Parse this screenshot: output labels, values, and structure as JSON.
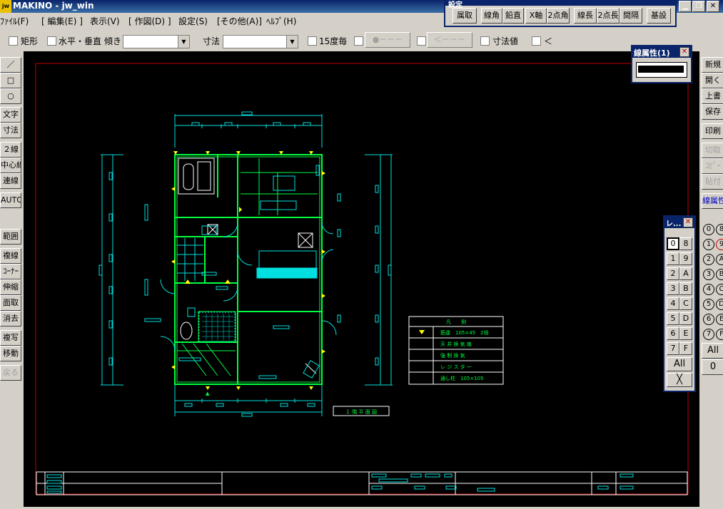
{
  "window": {
    "title": "MAKINO - jw_win",
    "icon": "jw"
  },
  "menu": [
    {
      "label": "ﾌｧｲﾙ(F)"
    },
    {
      "label": "[ 編集(E) ]"
    },
    {
      "label": "表示(V)"
    },
    {
      "label": "[ 作図(D) ]"
    },
    {
      "label": "設定(S)"
    },
    {
      "label": "[その他(A)]"
    },
    {
      "label": "ﾍﾙﾌﾟ(H)"
    }
  ],
  "settings_panel": {
    "title": "設定",
    "buttons": [
      "属取",
      "線角",
      "鉛直",
      "X軸",
      "2点角",
      "線長",
      "2点長",
      "間隔",
      "基設"
    ]
  },
  "toolbar": {
    "rect_label": "矩形",
    "hv_label": "水平・垂直",
    "slope_label": "傾き",
    "dim_label": "寸法",
    "deg15_label": "15度毎",
    "circle_btn": "●－－－",
    "arrow_btn": "＜－－－",
    "dimval_label": "寸法値",
    "lt_label": "＜"
  },
  "left_tools": [
    "／",
    "□",
    "○",
    "文字",
    "寸法",
    "２線",
    "中心線",
    "連線",
    "AUTO",
    "範囲",
    "複線",
    "ｺｰﾅｰ",
    "伸縮",
    "面取",
    "消去",
    "複写",
    "移動",
    "戻る"
  ],
  "right_tools": [
    "新規",
    "開く",
    "上書",
    "保存",
    "印刷",
    "切取",
    "ｺﾋﾟｰ",
    "貼付",
    "線属性"
  ],
  "line_attr_panel": {
    "title": "線属性(1)"
  },
  "layer_panel": {
    "title": "レ...",
    "rows": [
      [
        "0",
        "8"
      ],
      [
        "1",
        "9"
      ],
      [
        "2",
        "A"
      ],
      [
        "3",
        "B"
      ],
      [
        "4",
        "C"
      ],
      [
        "5",
        "D"
      ],
      [
        "6",
        "E"
      ],
      [
        "7",
        "F"
      ]
    ],
    "all_label": "All",
    "x_label": "╳"
  },
  "groups": {
    "rows": [
      [
        "0",
        "8"
      ],
      [
        "1",
        "9"
      ],
      [
        "2",
        "A"
      ],
      [
        "3",
        "B"
      ],
      [
        "4",
        "C"
      ],
      [
        "5",
        "D"
      ],
      [
        "6",
        "E"
      ],
      [
        "7",
        "F"
      ]
    ],
    "all_label": "All",
    "zero_label": "0"
  },
  "legend": {
    "title": "凡　　例",
    "items": [
      "筋違　105×45　2倍",
      "天 井 換 気 扇",
      "強 制 換 気",
      "レ ジ ス タ ー",
      "通し柱　105×105"
    ]
  },
  "plan_title": "１ 階 平 面 図",
  "colors": {
    "canvas": "#000000",
    "cyan": "#00e0e0",
    "green": "#00ff40",
    "yellow": "#ffff00",
    "white": "#ffffff",
    "border": "#c00000"
  }
}
